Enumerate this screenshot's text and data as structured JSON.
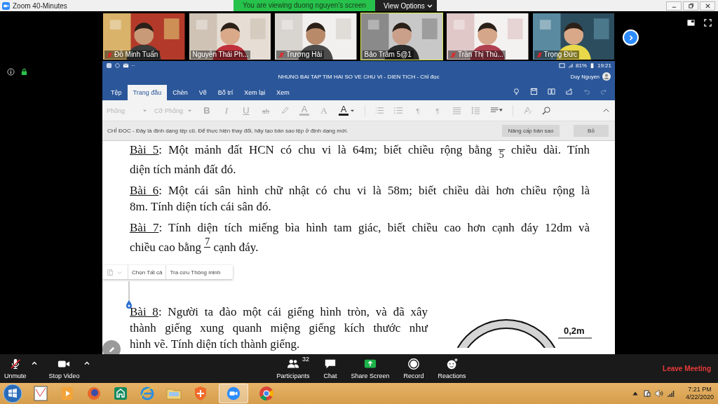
{
  "titlebar": {
    "title": "Zoom 40-Minutes",
    "banner": "You are viewing duong nguyen's screen",
    "view_options": "View Options"
  },
  "participants": [
    {
      "name": "Đỗ Minh Tuấn",
      "muted": true,
      "speaking": false
    },
    {
      "name": "Nguyễn Thái Ph...",
      "muted": false,
      "speaking": false
    },
    {
      "name": "Trương Hải",
      "muted": true,
      "speaking": false
    },
    {
      "name": "Bảo Trâm 5@1",
      "muted": false,
      "speaking": true
    },
    {
      "name": "Trần Thị Thù...",
      "muted": true,
      "speaking": false
    },
    {
      "name": "Trọng Đức",
      "muted": true,
      "speaking": false
    }
  ],
  "word": {
    "status_dots": "··",
    "battery": "81%",
    "clock": "19:21",
    "title": "NHUNG BAI TAP TIM HAI SO VE CHU VI - DIEN TICH - Chỉ đọc",
    "user": "Duy Nguyen",
    "tabs": [
      {
        "label": "Tệp",
        "selected": false
      },
      {
        "label": "Trang đầu",
        "selected": true
      },
      {
        "label": "Chèn",
        "selected": false
      },
      {
        "label": "Vẽ",
        "selected": false
      },
      {
        "label": "Bố trí",
        "selected": false
      },
      {
        "label": "Xem lại",
        "selected": false
      },
      {
        "label": "Xem",
        "selected": false
      }
    ],
    "ribbon": {
      "font_placeholder": "Phông",
      "size_placeholder": "Cỡ Phông",
      "glyphs": [
        "B",
        "I",
        "U",
        "ab",
        "A",
        "A",
        "A",
        "¶",
        "¶"
      ]
    },
    "notice": {
      "text": "CHỈ ĐỌC - Đây là định dạng tệp cũ. Để thực hiện thay đổi, hãy tạo bản sao tệp ở định dạng mới.",
      "buttons": [
        "Nâng cấp bản sao",
        "Bỏ"
      ]
    }
  },
  "document": {
    "paragraphs": [
      {
        "lines": [
          [
            {
              "kind": "underline",
              "text": "Bài 5"
            },
            {
              "kind": "text",
              "text": ": Một mảnh đất HCN có chu vi là 64m; biết chiều rộng bằng "
            },
            {
              "kind": "fraction",
              "denominator": "5"
            },
            {
              "kind": "text",
              "text": " chiều dài. Tính"
            }
          ],
          [
            {
              "kind": "text",
              "text": "diện tích mảnh đất đó."
            }
          ]
        ]
      },
      {
        "lines": [
          [
            {
              "kind": "underline",
              "text": "Bài 6"
            },
            {
              "kind": "text",
              "text": ": Một cái sân hình chữ nhật có chu vi là 58m; biết chiều dài hơn chiều rộng là"
            }
          ],
          [
            {
              "kind": "text",
              "text": "8m. Tính diện tích cái sân đó."
            }
          ]
        ]
      },
      {
        "lines": [
          [
            {
              "kind": "underline",
              "text": "Bài 7"
            },
            {
              "kind": "text",
              "text": ": Tính diện tích miếng bìa hình tam giác, biết chiều cao hơn cạnh đáy 12dm và"
            }
          ],
          [
            {
              "kind": "text",
              "text": "chiều cao bằng "
            },
            {
              "kind": "fraction",
              "numerator": "7"
            },
            {
              "kind": "text",
              "text": " cạnh đáy."
            }
          ]
        ]
      }
    ],
    "exercise_8": {
      "lines": [
        [
          {
            "kind": "underline",
            "text": "Bài 8"
          },
          {
            "kind": "text",
            "text": ": Người ta đào một cái giếng hình tròn, và đã xây"
          }
        ],
        [
          {
            "kind": "text",
            "text": "thành giếng xung quanh miệng giếng kích thước như"
          }
        ],
        [
          {
            "kind": "text",
            "text": "hình vẽ. Tính diện tích thành giếng."
          }
        ]
      ]
    },
    "figure_label": "0,2m"
  },
  "selection_toolbar": {
    "items": [
      "Chọn Tất cả",
      "Tra cứu Thông minh"
    ]
  },
  "toolbar": {
    "left": [
      {
        "kind": "mic",
        "label": "Unmute",
        "menu": true
      },
      {
        "kind": "video",
        "label": "Stop Video",
        "menu": true
      }
    ],
    "center": [
      {
        "kind": "participants",
        "label": "Participants",
        "count": "32"
      },
      {
        "kind": "chat",
        "label": "Chat"
      },
      {
        "kind": "share",
        "label": "Share Screen"
      },
      {
        "kind": "record",
        "label": "Record"
      },
      {
        "kind": "reactions",
        "label": "Reactions"
      }
    ],
    "leave": "Leave Meeting"
  },
  "taskbar": {
    "time": "7:21 PM",
    "date": "4/22/2020"
  }
}
